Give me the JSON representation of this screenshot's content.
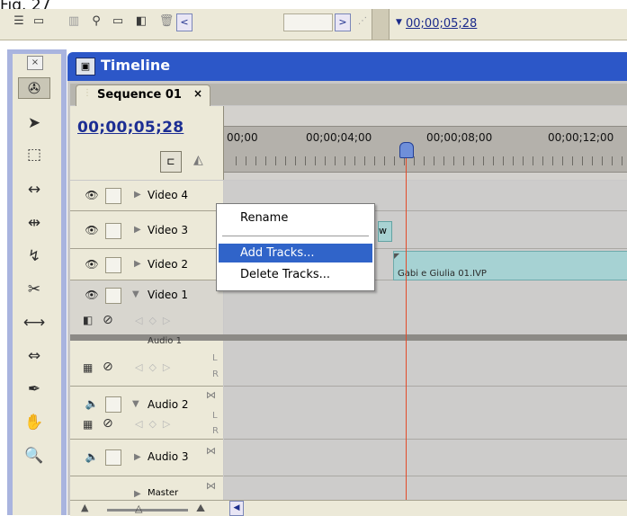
{
  "figure_label": "Fig. 27",
  "top_toolbar": {
    "timecode": "00;00;05;28",
    "scroll_left": "<",
    "scroll_right": ">"
  },
  "tools": {
    "close": "×",
    "items": [
      {
        "name": "track-select-tool",
        "glyph": "✇"
      },
      {
        "name": "selection-tool",
        "glyph": "➤"
      },
      {
        "name": "range-select-tool",
        "glyph": "⬚"
      },
      {
        "name": "ripple-edit-tool",
        "glyph": "↔"
      },
      {
        "name": "rolling-edit-tool",
        "glyph": "⇹"
      },
      {
        "name": "rate-stretch-tool",
        "glyph": "↯"
      },
      {
        "name": "razor-tool",
        "glyph": "✂"
      },
      {
        "name": "slip-tool",
        "glyph": "⟷"
      },
      {
        "name": "slide-tool",
        "glyph": "⇔"
      },
      {
        "name": "pen-tool",
        "glyph": "✒"
      },
      {
        "name": "hand-tool",
        "glyph": "✋"
      },
      {
        "name": "zoom-tool",
        "glyph": "🔍"
      }
    ]
  },
  "timeline": {
    "title": "Timeline",
    "tab": {
      "label": "Sequence 01",
      "close": "×"
    },
    "current_timecode": "00;00;05;28",
    "ruler_labels": [
      "00;00",
      "00;00;04;00",
      "00;00;08;00",
      "00;00;12;00"
    ],
    "tracks": [
      {
        "name": "Video 4"
      },
      {
        "name": "Video 3"
      },
      {
        "name": "Video 2"
      },
      {
        "name": "Video 1"
      },
      {
        "name": "Audio 1"
      },
      {
        "name": "Audio 2"
      },
      {
        "name": "Audio 3"
      },
      {
        "name": "Master"
      }
    ],
    "clips": {
      "video3_clip_fragment": "w",
      "video2_clip": "Gabi e Giulia 01.IVP"
    },
    "channel_labels": {
      "left": "L",
      "right": "R"
    }
  },
  "context_menu": {
    "items": [
      {
        "label": "Rename",
        "highlighted": false
      },
      {
        "label": "Add Tracks...",
        "highlighted": true
      },
      {
        "label": "Delete Tracks...",
        "highlighted": false
      }
    ]
  },
  "colors": {
    "title_bar": "#2c57c8",
    "menu_highlight": "#3064c9",
    "playhead_line": "#e24b2a",
    "clip": "#a6d2d3",
    "timecode": "#1c2e93"
  }
}
